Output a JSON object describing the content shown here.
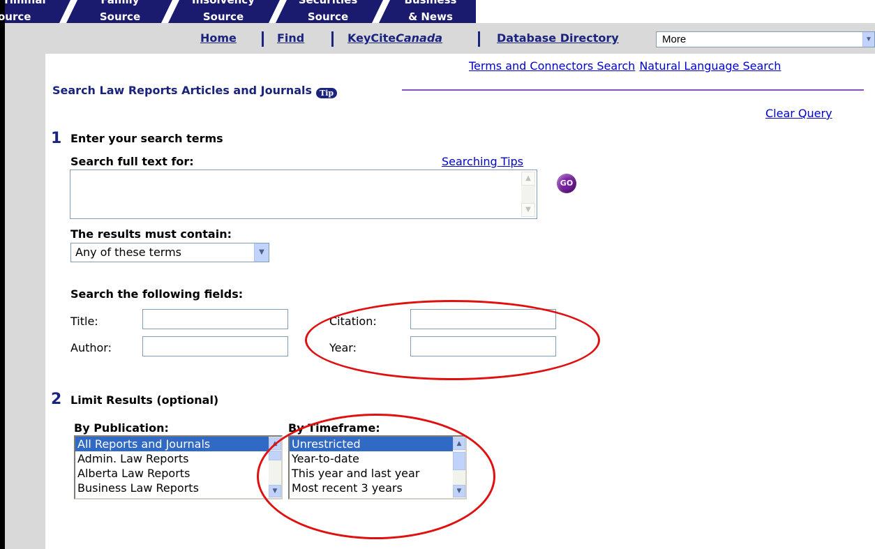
{
  "tabs": [
    {
      "line1": "riminal",
      "line2": "Source"
    },
    {
      "line1": "Family",
      "line2": "Source"
    },
    {
      "line1": "Insolvency",
      "line2": "Source"
    },
    {
      "line1": "Securities",
      "line2": "Source"
    },
    {
      "line1": "Business",
      "line2": "& News"
    }
  ],
  "nav": {
    "home": "Home",
    "find": "Find",
    "keycite_prefix": "KeyCite",
    "keycite_suffix": "Canada",
    "database_directory": "Database Directory",
    "more_select": "More"
  },
  "search_mode_links": {
    "terms_connectors": "Terms and Connectors Search",
    "natural_language": "Natural Language Search"
  },
  "heading": {
    "title": "Search Law Reports Articles and Journals",
    "tip_badge": "Tip"
  },
  "clear_query": "Clear Query",
  "step1": {
    "number": "1",
    "title": "Enter your search terms",
    "search_full_text_label": "Search full text for:",
    "searching_tips": "Searching Tips",
    "search_text_value": "",
    "go_button": "GO",
    "results_must_contain_label": "The results must contain:",
    "results_must_contain_value": "Any of these terms",
    "fields_label": "Search the following fields:",
    "fields": {
      "title": "Title:",
      "author": "Author:",
      "citation": "Citation:",
      "year": "Year:"
    }
  },
  "step2": {
    "number": "2",
    "title": "Limit Results (optional)",
    "by_publication_label": "By Publication:",
    "publications": [
      "All Reports and Journals",
      "Admin. Law Reports",
      "Alberta Law Reports",
      "Business Law Reports"
    ],
    "by_timeframe_label": "By Timeframe:",
    "timeframes": [
      "Unrestricted",
      "Year-to-date",
      "This year and last year",
      "Most recent 3 years"
    ]
  },
  "colors": {
    "tab_bg": "#1a1a6e",
    "nav_link": "#1a237e",
    "link_blue": "#0000cc",
    "heading_rule": "#8a4fb6",
    "annotation_red": "#e01010",
    "selected_option": "#316ac5"
  }
}
